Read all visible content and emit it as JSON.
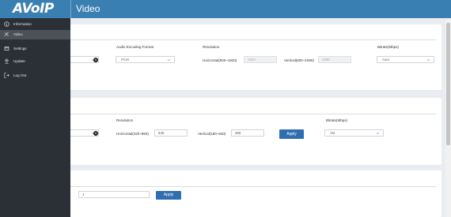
{
  "header": {
    "logo": "AVoIP",
    "title": "Video"
  },
  "sidebar": {
    "items": [
      {
        "label": "Information",
        "icon": "info-circle-icon"
      },
      {
        "label": "Video",
        "icon": "video-icon",
        "active": true
      },
      {
        "label": "Settings",
        "icon": "settings-icon"
      },
      {
        "label": "Update",
        "icon": "update-icon"
      },
      {
        "label": "Log Out",
        "icon": "logout-icon"
      }
    ]
  },
  "card1": {
    "audio_format_label": "Audio Encoding Format",
    "audio_format_value": "PCM",
    "resolution_label": "Resolution",
    "horizontal_label": "Horizontal(800~1920)",
    "horizontal_value": "1920",
    "vertical_label": "Vertical(600~1080)",
    "vertical_value": "1080",
    "bitrate_label": "Bitrate(Mbps)",
    "bitrate_value": "Auto"
  },
  "card2": {
    "resolution_label": "Resolution",
    "horizontal_label": "Horizontal(320~960)",
    "horizontal_value": "640",
    "vertical_label": "Vertical(180~540)",
    "vertical_value": "360",
    "apply_label": "Apply",
    "bitrate_label": "Bitrate(Mbps)",
    "bitrate_value": "1M"
  },
  "card3": {
    "value": "1",
    "apply_label": "Apply"
  },
  "colors": {
    "header": "#3a7fb1",
    "sidebar": "#2b3036",
    "button": "#2f6fb0"
  }
}
